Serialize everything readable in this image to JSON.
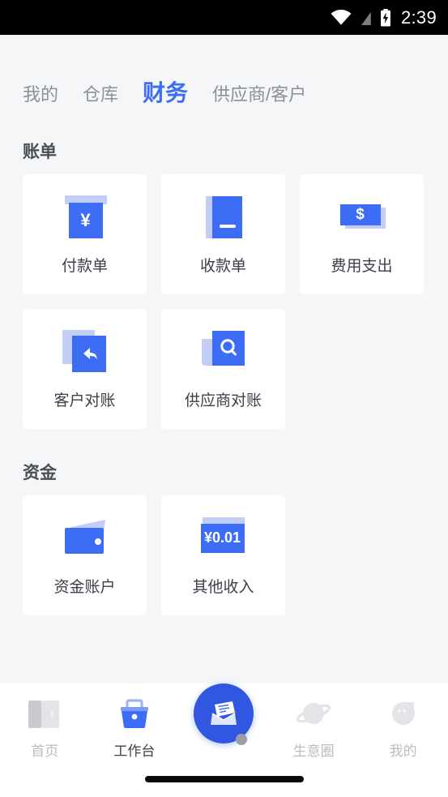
{
  "status_bar": {
    "time": "2:39",
    "icons": [
      "wifi-icon",
      "signal-off-icon",
      "battery-charging-icon"
    ]
  },
  "tabs": [
    {
      "label": "我的",
      "active": false
    },
    {
      "label": "仓库",
      "active": false
    },
    {
      "label": "财务",
      "active": true
    },
    {
      "label": "供应商/客户",
      "active": false
    }
  ],
  "sections": [
    {
      "title": "账单",
      "cards": [
        {
          "label": "付款单",
          "icon": "payment-voucher-icon"
        },
        {
          "label": "收款单",
          "icon": "receipt-voucher-icon"
        },
        {
          "label": "费用支出",
          "icon": "expense-banknote-icon"
        },
        {
          "label": "客户对账",
          "icon": "customer-reconciliation-icon"
        },
        {
          "label": "供应商对账",
          "icon": "supplier-reconciliation-icon"
        }
      ]
    },
    {
      "title": "资金",
      "cards": [
        {
          "label": "资金账户",
          "icon": "wallet-icon"
        },
        {
          "label": "其他收入",
          "icon": "other-income-icon",
          "amount": "¥0.01"
        }
      ]
    }
  ],
  "bottom_nav": [
    {
      "label": "首页",
      "icon": "home-icon",
      "active": false
    },
    {
      "label": "工作台",
      "icon": "workbench-icon",
      "active": true
    },
    {
      "label": "生意圈",
      "icon": "business-circle-icon",
      "active": false
    },
    {
      "label": "我的",
      "icon": "profile-icon",
      "active": false
    }
  ],
  "fab": {
    "icon": "compose-document-icon",
    "badge": true
  },
  "colors": {
    "accent": "#3d6df5",
    "accent_dark": "#3157e0",
    "accent_pale": "#c3cef7",
    "page_bg": "#f5f6f8",
    "card_bg": "#ffffff",
    "text_primary": "#3d4049",
    "text_muted": "#8b8f99",
    "nav_inactive": "#b9bcc4"
  }
}
